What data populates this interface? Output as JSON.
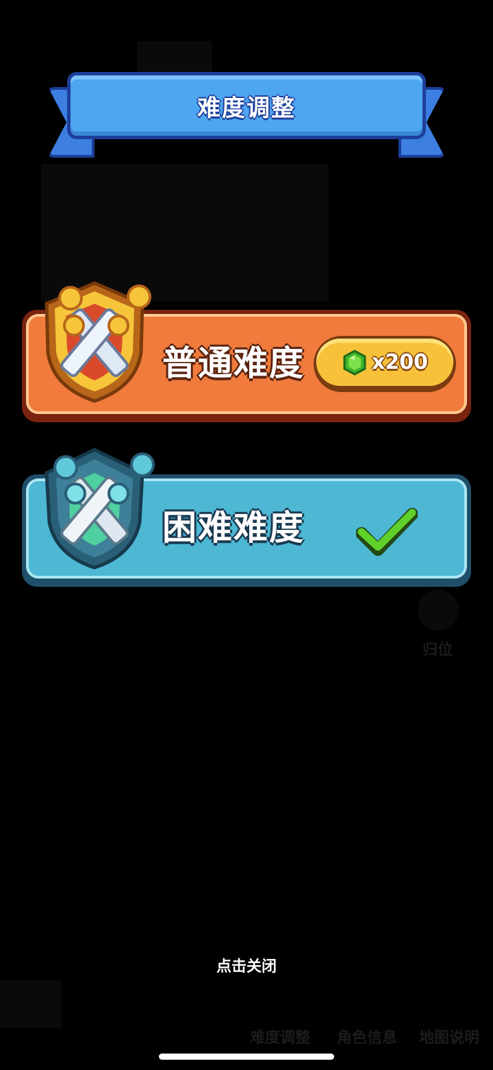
{
  "header": {
    "title": "难度调整"
  },
  "difficulties": [
    {
      "label": "普通难度",
      "cost": "x200",
      "selected": false,
      "cost_icon": "green-gem-icon"
    },
    {
      "label": "困难难度",
      "selected": true,
      "status_icon": "checkmark-icon"
    }
  ],
  "footer": {
    "close_hint": "点击关闭"
  },
  "background": {
    "ghost_labels": [
      "归位",
      "难度调整",
      "角色信息",
      "地图说明"
    ]
  },
  "colors": {
    "ribbon_blue": "#4ea5f0",
    "normal_orange": "#f07b3c",
    "hard_teal": "#4db7d4",
    "gold": "#f7c23a",
    "check_green": "#5fd12a"
  }
}
